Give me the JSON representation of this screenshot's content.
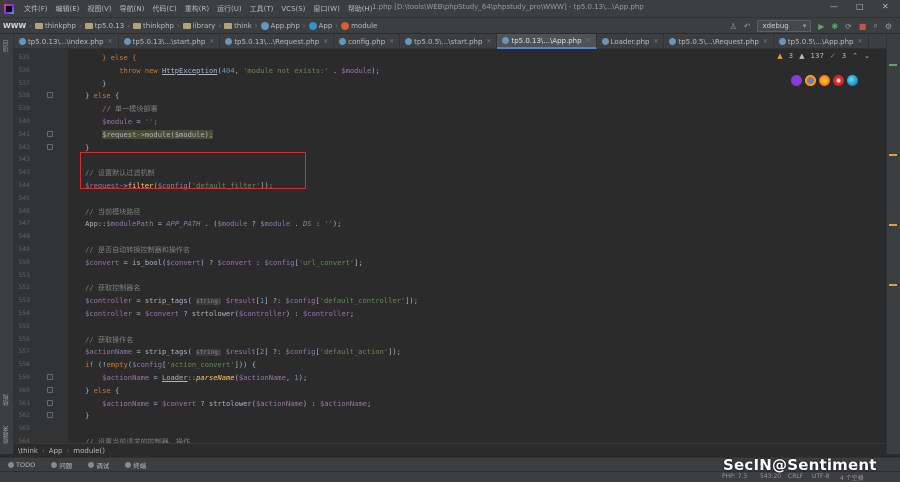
{
  "menubar": {
    "menus": [
      "文件(F)",
      "编辑(E)",
      "视图(V)",
      "导航(N)",
      "代码(C)",
      "重构(R)",
      "运行(U)",
      "工具(T)",
      "VCS(S)",
      "窗口(W)",
      "帮助(H)"
    ],
    "window_title": "1.php [D:\\tools\\WEB\\phpStudy_64\\phpstudy_pro\\WWW] - tp5.0.13\\...\\App.php"
  },
  "navbar": {
    "crumbs": [
      "WWW",
      "thinkphp",
      "tp5.0.13",
      "thinkphp",
      "library",
      "think",
      "App.php",
      "App",
      "module"
    ],
    "run_config": "xdebug"
  },
  "tabs": [
    {
      "label": "tp5.0.13\\...\\index.php",
      "active": false
    },
    {
      "label": "tp5.0.13\\...\\start.php",
      "active": false
    },
    {
      "label": "tp5.0.13\\...\\Request.php",
      "active": false
    },
    {
      "label": "config.php",
      "active": false
    },
    {
      "label": "tp5.0.5\\...\\start.php",
      "active": false
    },
    {
      "label": "tp5.0.13\\...\\App.php",
      "active": true
    },
    {
      "label": "Loader.php",
      "active": false
    },
    {
      "label": "tp5.0.5\\...\\Request.php",
      "active": false
    },
    {
      "label": "tp5.0.5\\...\\App.php",
      "active": false
    }
  ],
  "left_tool_windows": [
    "项目",
    "结构",
    "收藏夹"
  ],
  "inspections": {
    "warnings": "3",
    "weak_warnings": "137",
    "typos": "3"
  },
  "code": {
    "lines": [
      {
        "n": "535",
        "tokens": [
          [
            "",
            "        "
          ],
          [
            "k",
            "} else {"
          ]
        ]
      },
      {
        "n": "536",
        "tokens": [
          [
            "",
            "            "
          ],
          [
            "k",
            "throw new "
          ],
          [
            "cls",
            "HttpException"
          ],
          [
            "",
            "("
          ],
          [
            "num",
            "404"
          ],
          [
            "",
            ", "
          ],
          [
            "s",
            "'module not exists:'"
          ],
          [
            "",
            " . "
          ],
          [
            "v",
            "$module"
          ],
          [
            "",
            ");"
          ]
        ]
      },
      {
        "n": "537",
        "tokens": [
          [
            "",
            "        }"
          ]
        ]
      },
      {
        "n": "538",
        "tokens": [
          [
            "",
            "    } "
          ],
          [
            "k",
            "else"
          ],
          [
            "",
            " {"
          ]
        ]
      },
      {
        "n": "539",
        "tokens": [
          [
            "",
            "        "
          ],
          [
            "c",
            "// 单一模块部署"
          ]
        ]
      },
      {
        "n": "540",
        "tokens": [
          [
            "",
            "        "
          ],
          [
            "v",
            "$module"
          ],
          [
            "",
            " = "
          ],
          [
            "s",
            "''"
          ],
          [
            "k",
            ";"
          ]
        ]
      },
      {
        "n": "541",
        "tokens": [
          [
            "",
            "        "
          ],
          [
            "hl",
            "$request->module($module);"
          ]
        ]
      },
      {
        "n": "542",
        "tokens": [
          [
            "",
            "    }"
          ]
        ]
      },
      {
        "n": "543",
        "tokens": []
      },
      {
        "n": "543",
        "tokens": [
          [
            "",
            "    "
          ],
          [
            "c",
            "// 设置默认过滤机制"
          ]
        ]
      },
      {
        "n": "544",
        "tokens": [
          [
            "",
            "    "
          ],
          [
            "v",
            "$request"
          ],
          [
            "",
            "->"
          ],
          [
            "f",
            "filter"
          ],
          [
            "",
            "("
          ],
          [
            "v",
            "$config"
          ],
          [
            "",
            "["
          ],
          [
            "s",
            "'default_filter'"
          ],
          [
            "",
            "]);"
          ]
        ]
      },
      {
        "n": "545",
        "tokens": []
      },
      {
        "n": "546",
        "tokens": [
          [
            "",
            "    "
          ],
          [
            "c",
            "// 当前模块路径"
          ]
        ]
      },
      {
        "n": "547",
        "tokens": [
          [
            "",
            "    App::"
          ],
          [
            "v",
            "$modulePath"
          ],
          [
            "",
            " = "
          ],
          [
            "cn",
            "APP_PATH"
          ],
          [
            "",
            " . ("
          ],
          [
            "v",
            "$module"
          ],
          [
            "",
            " ? "
          ],
          [
            "v",
            "$module"
          ],
          [
            "",
            " . "
          ],
          [
            "cn",
            "DS"
          ],
          [
            "",
            " : "
          ],
          [
            "s",
            "''"
          ],
          [
            "",
            ");"
          ]
        ]
      },
      {
        "n": "548",
        "tokens": []
      },
      {
        "n": "549",
        "tokens": [
          [
            "",
            "    "
          ],
          [
            "c",
            "// 是否自动转换控制器和操作名"
          ]
        ]
      },
      {
        "n": "550",
        "tokens": [
          [
            "",
            "    "
          ],
          [
            "v",
            "$convert"
          ],
          [
            "",
            " = is_bool("
          ],
          [
            "v",
            "$convert"
          ],
          [
            "",
            ") ? "
          ],
          [
            "v",
            "$convert"
          ],
          [
            "",
            " : "
          ],
          [
            "v",
            "$config"
          ],
          [
            "",
            "["
          ],
          [
            "s",
            "'url_convert'"
          ],
          [
            "",
            "];"
          ]
        ]
      },
      {
        "n": "551",
        "tokens": []
      },
      {
        "n": "552",
        "tokens": [
          [
            "",
            "    "
          ],
          [
            "c",
            "// 获取控制器名"
          ]
        ]
      },
      {
        "n": "553",
        "tokens": [
          [
            "",
            "    "
          ],
          [
            "v",
            "$controller"
          ],
          [
            "",
            " = strip_tags( "
          ],
          [
            "hint",
            "string:"
          ],
          [
            "",
            " "
          ],
          [
            "v",
            "$result"
          ],
          [
            "",
            "["
          ],
          [
            "num",
            "1"
          ],
          [
            "",
            "] ?: "
          ],
          [
            "v",
            "$config"
          ],
          [
            "",
            "["
          ],
          [
            "s",
            "'default_controller'"
          ],
          [
            "",
            "]);"
          ]
        ]
      },
      {
        "n": "554",
        "tokens": [
          [
            "",
            "    "
          ],
          [
            "v",
            "$controller"
          ],
          [
            "",
            " = "
          ],
          [
            "v",
            "$convert"
          ],
          [
            "",
            " ? strtolower("
          ],
          [
            "v",
            "$controller"
          ],
          [
            "",
            ") : "
          ],
          [
            "v",
            "$controller"
          ],
          [
            "",
            ";"
          ]
        ]
      },
      {
        "n": "555",
        "tokens": []
      },
      {
        "n": "556",
        "tokens": [
          [
            "",
            "    "
          ],
          [
            "c",
            "// 获取操作名"
          ]
        ]
      },
      {
        "n": "557",
        "tokens": [
          [
            "",
            "    "
          ],
          [
            "v",
            "$actionName"
          ],
          [
            "",
            " = strip_tags( "
          ],
          [
            "hint",
            "string:"
          ],
          [
            "",
            " "
          ],
          [
            "v",
            "$result"
          ],
          [
            "",
            "["
          ],
          [
            "num",
            "2"
          ],
          [
            "",
            "] ?: "
          ],
          [
            "v",
            "$config"
          ],
          [
            "",
            "["
          ],
          [
            "s",
            "'default_action'"
          ],
          [
            "",
            "]);"
          ]
        ]
      },
      {
        "n": "558",
        "tokens": [
          [
            "",
            "    "
          ],
          [
            "k",
            "if"
          ],
          [
            "",
            " (!"
          ],
          [
            "k",
            "empty"
          ],
          [
            "",
            "("
          ],
          [
            "v",
            "$config"
          ],
          [
            "",
            "["
          ],
          [
            "s",
            "'action_convert'"
          ],
          [
            "",
            "])) {"
          ]
        ]
      },
      {
        "n": "559",
        "tokens": [
          [
            "",
            "        "
          ],
          [
            "v",
            "$actionName"
          ],
          [
            "",
            " = "
          ],
          [
            "cls",
            "Loader"
          ],
          [
            "",
            "::"
          ],
          [
            "smeth",
            "parseName"
          ],
          [
            "",
            "("
          ],
          [
            "v",
            "$actionName"
          ],
          [
            "",
            ", "
          ],
          [
            "num",
            "1"
          ],
          [
            "",
            ");"
          ]
        ]
      },
      {
        "n": "560",
        "tokens": [
          [
            "",
            "    } "
          ],
          [
            "k",
            "else"
          ],
          [
            "",
            " {"
          ]
        ]
      },
      {
        "n": "561",
        "tokens": [
          [
            "",
            "        "
          ],
          [
            "v",
            "$actionName"
          ],
          [
            "",
            " = "
          ],
          [
            "v",
            "$convert"
          ],
          [
            "",
            " ? strtolower("
          ],
          [
            "v",
            "$actionName"
          ],
          [
            "",
            ") : "
          ],
          [
            "v",
            "$actionName"
          ],
          [
            "",
            ";"
          ]
        ]
      },
      {
        "n": "562",
        "tokens": [
          [
            "",
            "    }"
          ]
        ]
      },
      {
        "n": "563",
        "tokens": []
      },
      {
        "n": "564",
        "tokens": [
          [
            "",
            "    "
          ],
          [
            "c",
            "// 设置当前请求的控制器、操作"
          ]
        ]
      }
    ]
  },
  "breadcrumb": [
    "\\think",
    "App",
    "module()"
  ],
  "bottom_tools": [
    "TODO",
    "问题",
    "调试",
    "终端"
  ],
  "status": {
    "php": "PHP: 7.3",
    "position": "543:20",
    "line_sep": "CRLF",
    "encoding": "UTF-8",
    "indent": "4 个空格"
  },
  "watermark": "SecIN@Sentiment",
  "colors": {
    "accent": "#4a88c7",
    "highlight_box": "#d32f2f"
  }
}
